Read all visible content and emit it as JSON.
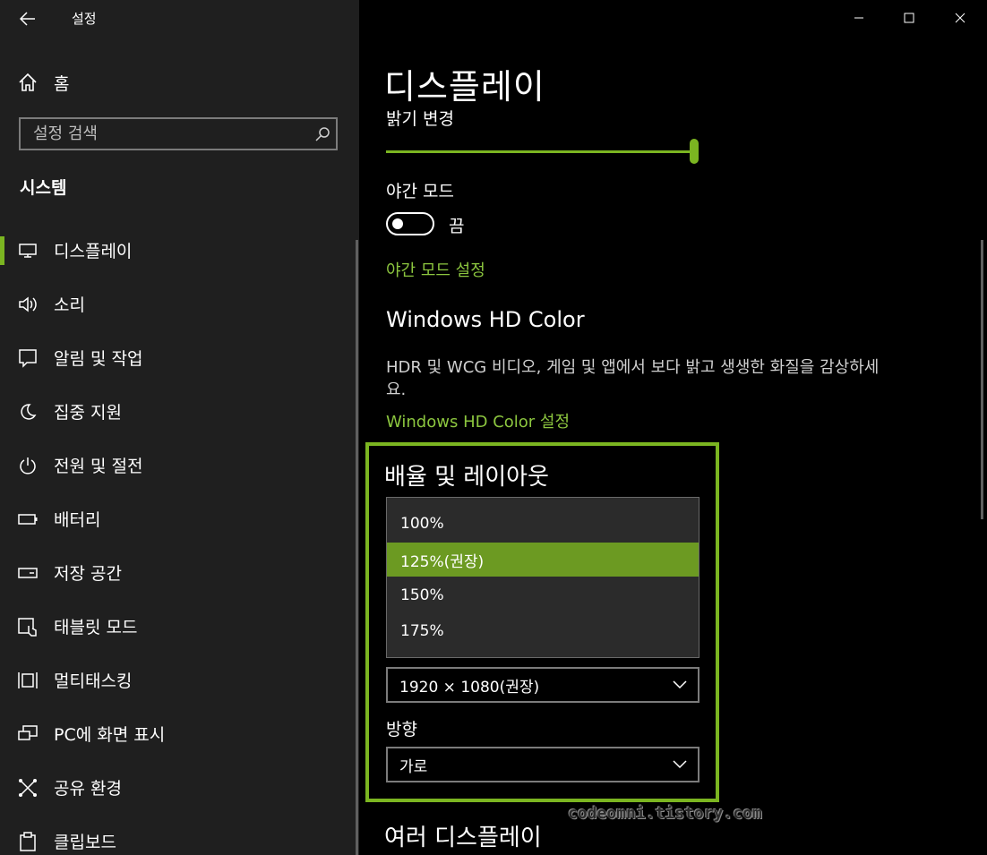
{
  "app": {
    "title": "설정",
    "back_icon": "back-arrow-icon"
  },
  "window_controls": {
    "minimize_icon": "minimize-icon",
    "maximize_icon": "maximize-icon",
    "close_icon": "close-icon"
  },
  "sidebar": {
    "home_label": "홈",
    "search_placeholder": "설정 검색",
    "section_label": "시스템",
    "items": [
      {
        "label": "디스플레이",
        "icon": "monitor-icon",
        "active": true
      },
      {
        "label": "소리",
        "icon": "speaker-icon"
      },
      {
        "label": "알림 및 작업",
        "icon": "notification-icon"
      },
      {
        "label": "집중 지원",
        "icon": "moon-icon"
      },
      {
        "label": "전원 및 절전",
        "icon": "power-icon"
      },
      {
        "label": "배터리",
        "icon": "battery-icon"
      },
      {
        "label": "저장 공간",
        "icon": "storage-icon"
      },
      {
        "label": "태블릿 모드",
        "icon": "tablet-icon"
      },
      {
        "label": "멀티태스킹",
        "icon": "multitasking-icon"
      },
      {
        "label": "PC에 화면 표시",
        "icon": "project-icon"
      },
      {
        "label": "공유 환경",
        "icon": "share-icon"
      },
      {
        "label": "클립보드",
        "icon": "clipboard-icon"
      }
    ]
  },
  "main": {
    "title": "디스플레이",
    "brightness_label": "밝기 변경",
    "brightness_value": 100,
    "night_mode_label": "야간 모드",
    "night_mode_state": "끔",
    "night_mode_link": "야간 모드 설정",
    "hd_title": "Windows HD Color",
    "hd_desc": "HDR 및 WCG 비디오, 게임 및 앱에서 보다 밝고 생생한 화질을 감상하세요.",
    "hd_link": "Windows HD Color 설정",
    "scale_title": "배율 및 레이아웃",
    "scale_options": [
      "100%",
      "125%(권장)",
      "150%",
      "175%"
    ],
    "scale_selected": "125%(권장)",
    "resolution_value": "1920 × 1080(권장)",
    "orientation_label": "방향",
    "orientation_value": "가로",
    "multi_display_title": "여러 디스플레이",
    "watermark": "codeomni.tistory.com"
  },
  "colors": {
    "accent": "#7bb521",
    "selected": "#6c9a22",
    "link": "#8cc63f"
  }
}
